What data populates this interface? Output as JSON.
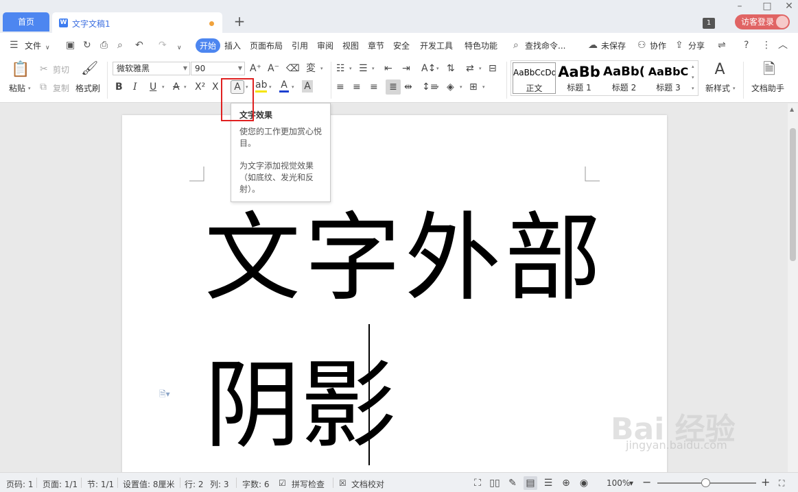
{
  "tabs": {
    "home": "首页",
    "doc_title": "文字文稿1",
    "add": "+"
  },
  "window": {
    "badge": "1",
    "visitor_login": "访客登录"
  },
  "menu": {
    "file": "文件",
    "items": [
      "开始",
      "插入",
      "页面布局",
      "引用",
      "审阅",
      "视图",
      "章节",
      "安全",
      "开发工具",
      "特色功能"
    ],
    "search": "查找命令...",
    "unsaved": "未保存",
    "collab": "协作",
    "share": "分享"
  },
  "ribbon": {
    "paste": "粘贴",
    "cut": "剪切",
    "copy": "复制",
    "format_painter": "格式刷",
    "font_name": "微软雅黑",
    "font_size": "90",
    "styles": [
      {
        "sample": "AaBbCcDd",
        "name": "正文"
      },
      {
        "sample": "AaBb",
        "name": "标题 1"
      },
      {
        "sample": "AaBb(",
        "name": "标题 2"
      },
      {
        "sample": "AaBbC",
        "name": "标题 3"
      }
    ],
    "new_style": "新样式",
    "doc_assistant": "文档助手"
  },
  "tooltip": {
    "title": "文字效果",
    "line1": "使您的工作更加赏心悦",
    "line2": "目。",
    "line3": "为文字添加视觉效果",
    "line4": "（如底纹、发光和反",
    "line5": "射）。"
  },
  "document": {
    "line1": "文字外部",
    "line2": "阴影"
  },
  "status": {
    "page_no": "页码: 1",
    "pages": "页面: 1/1",
    "section": "节: 1/1",
    "setting": "设置值: 8厘米",
    "row": "行: 2",
    "col": "列: 3",
    "word_count": "字数: 6",
    "spell_check": "拼写检查",
    "proofread": "文档校对",
    "zoom": "100%"
  },
  "watermark": {
    "main": "Bai 经验",
    "sub": "jingyan.baidu.com"
  }
}
